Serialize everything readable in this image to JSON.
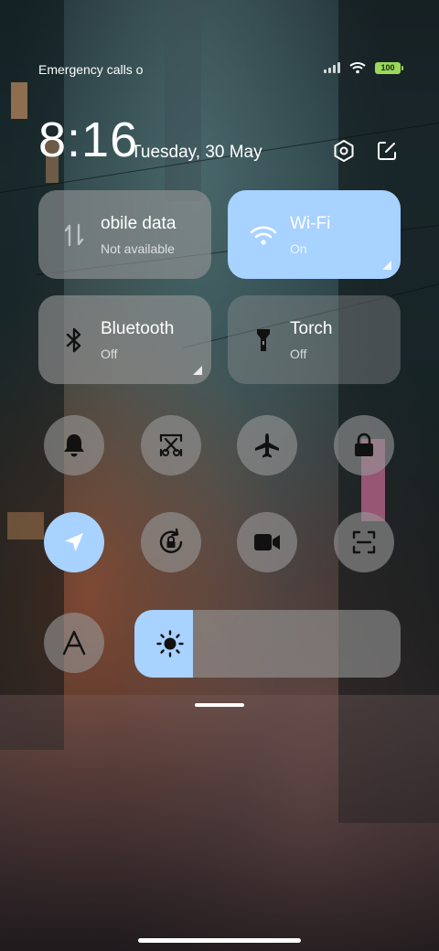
{
  "status_bar": {
    "carrier_text": "Emergency calls o",
    "battery": "100"
  },
  "header": {
    "time": "8:16",
    "date": "Tuesday, 30 May"
  },
  "tiles": {
    "mobile_data": {
      "title": "obile data",
      "subtitle": "Not available",
      "active": false
    },
    "wifi": {
      "title": "Wi-Fi",
      "subtitle": "On",
      "active": true
    },
    "bluetooth": {
      "title": "Bluetooth",
      "subtitle": "Off",
      "active": false
    },
    "torch": {
      "title": "Torch",
      "subtitle": "Off",
      "active": false
    }
  },
  "toggles": [
    {
      "icon": "bell-icon",
      "active": false
    },
    {
      "icon": "screenshot-scissors-icon",
      "active": false
    },
    {
      "icon": "airplane-icon",
      "active": false
    },
    {
      "icon": "lock-icon",
      "active": false
    },
    {
      "icon": "location-arrow-icon",
      "active": true
    },
    {
      "icon": "rotation-lock-icon",
      "active": false
    },
    {
      "icon": "video-camera-icon",
      "active": false
    },
    {
      "icon": "scan-icon",
      "active": false
    },
    {
      "icon": "font-a-icon",
      "active": false
    }
  ],
  "brightness": {
    "level": 0.22
  },
  "colors": {
    "active_tile": "#a8d2ff",
    "inactive_tile": "rgba(150,150,150,0.62)",
    "battery": "#9ad85a"
  }
}
